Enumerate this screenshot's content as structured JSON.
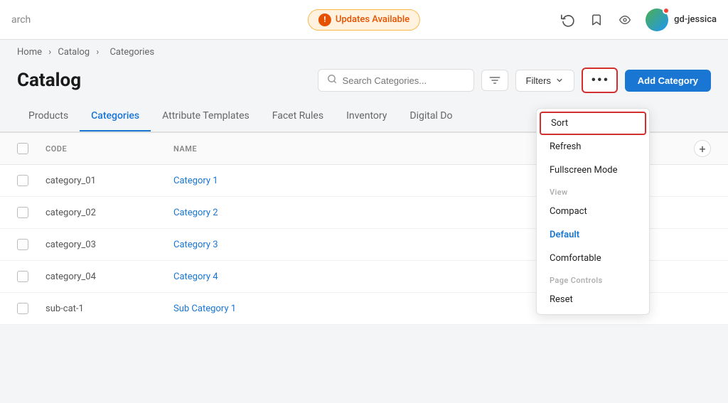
{
  "navbar": {
    "search_partial": "arch",
    "updates_label": "Updates Available",
    "username": "gd-jessica"
  },
  "breadcrumb": {
    "home": "Home",
    "catalog": "Catalog",
    "current": "Categories"
  },
  "page": {
    "title": "Catalog",
    "search_placeholder": "Search Categories...",
    "filters_label": "Filters",
    "add_button_label": "Add Category"
  },
  "tabs": [
    {
      "id": "products",
      "label": "Products",
      "active": false
    },
    {
      "id": "categories",
      "label": "Categories",
      "active": true
    },
    {
      "id": "attribute-templates",
      "label": "Attribute Templates",
      "active": false
    },
    {
      "id": "facet-rules",
      "label": "Facet Rules",
      "active": false
    },
    {
      "id": "inventory",
      "label": "Inventory",
      "active": false
    },
    {
      "id": "digital-do",
      "label": "Digital Do",
      "active": false
    }
  ],
  "table": {
    "headers": {
      "code": "CODE",
      "name": "NAME"
    },
    "rows": [
      {
        "code": "category_01",
        "name": "Category 1"
      },
      {
        "code": "category_02",
        "name": "Category 2"
      },
      {
        "code": "category_03",
        "name": "Category 3"
      },
      {
        "code": "category_04",
        "name": "Category 4"
      },
      {
        "code": "sub-cat-1",
        "name": "Sub Category 1"
      }
    ]
  },
  "dropdown": {
    "sort_label": "Sort",
    "refresh_label": "Refresh",
    "fullscreen_label": "Fullscreen Mode",
    "view_section": "View",
    "compact_label": "Compact",
    "default_label": "Default",
    "comfortable_label": "Comfortable",
    "page_controls_section": "Page Controls",
    "reset_label": "Reset"
  }
}
